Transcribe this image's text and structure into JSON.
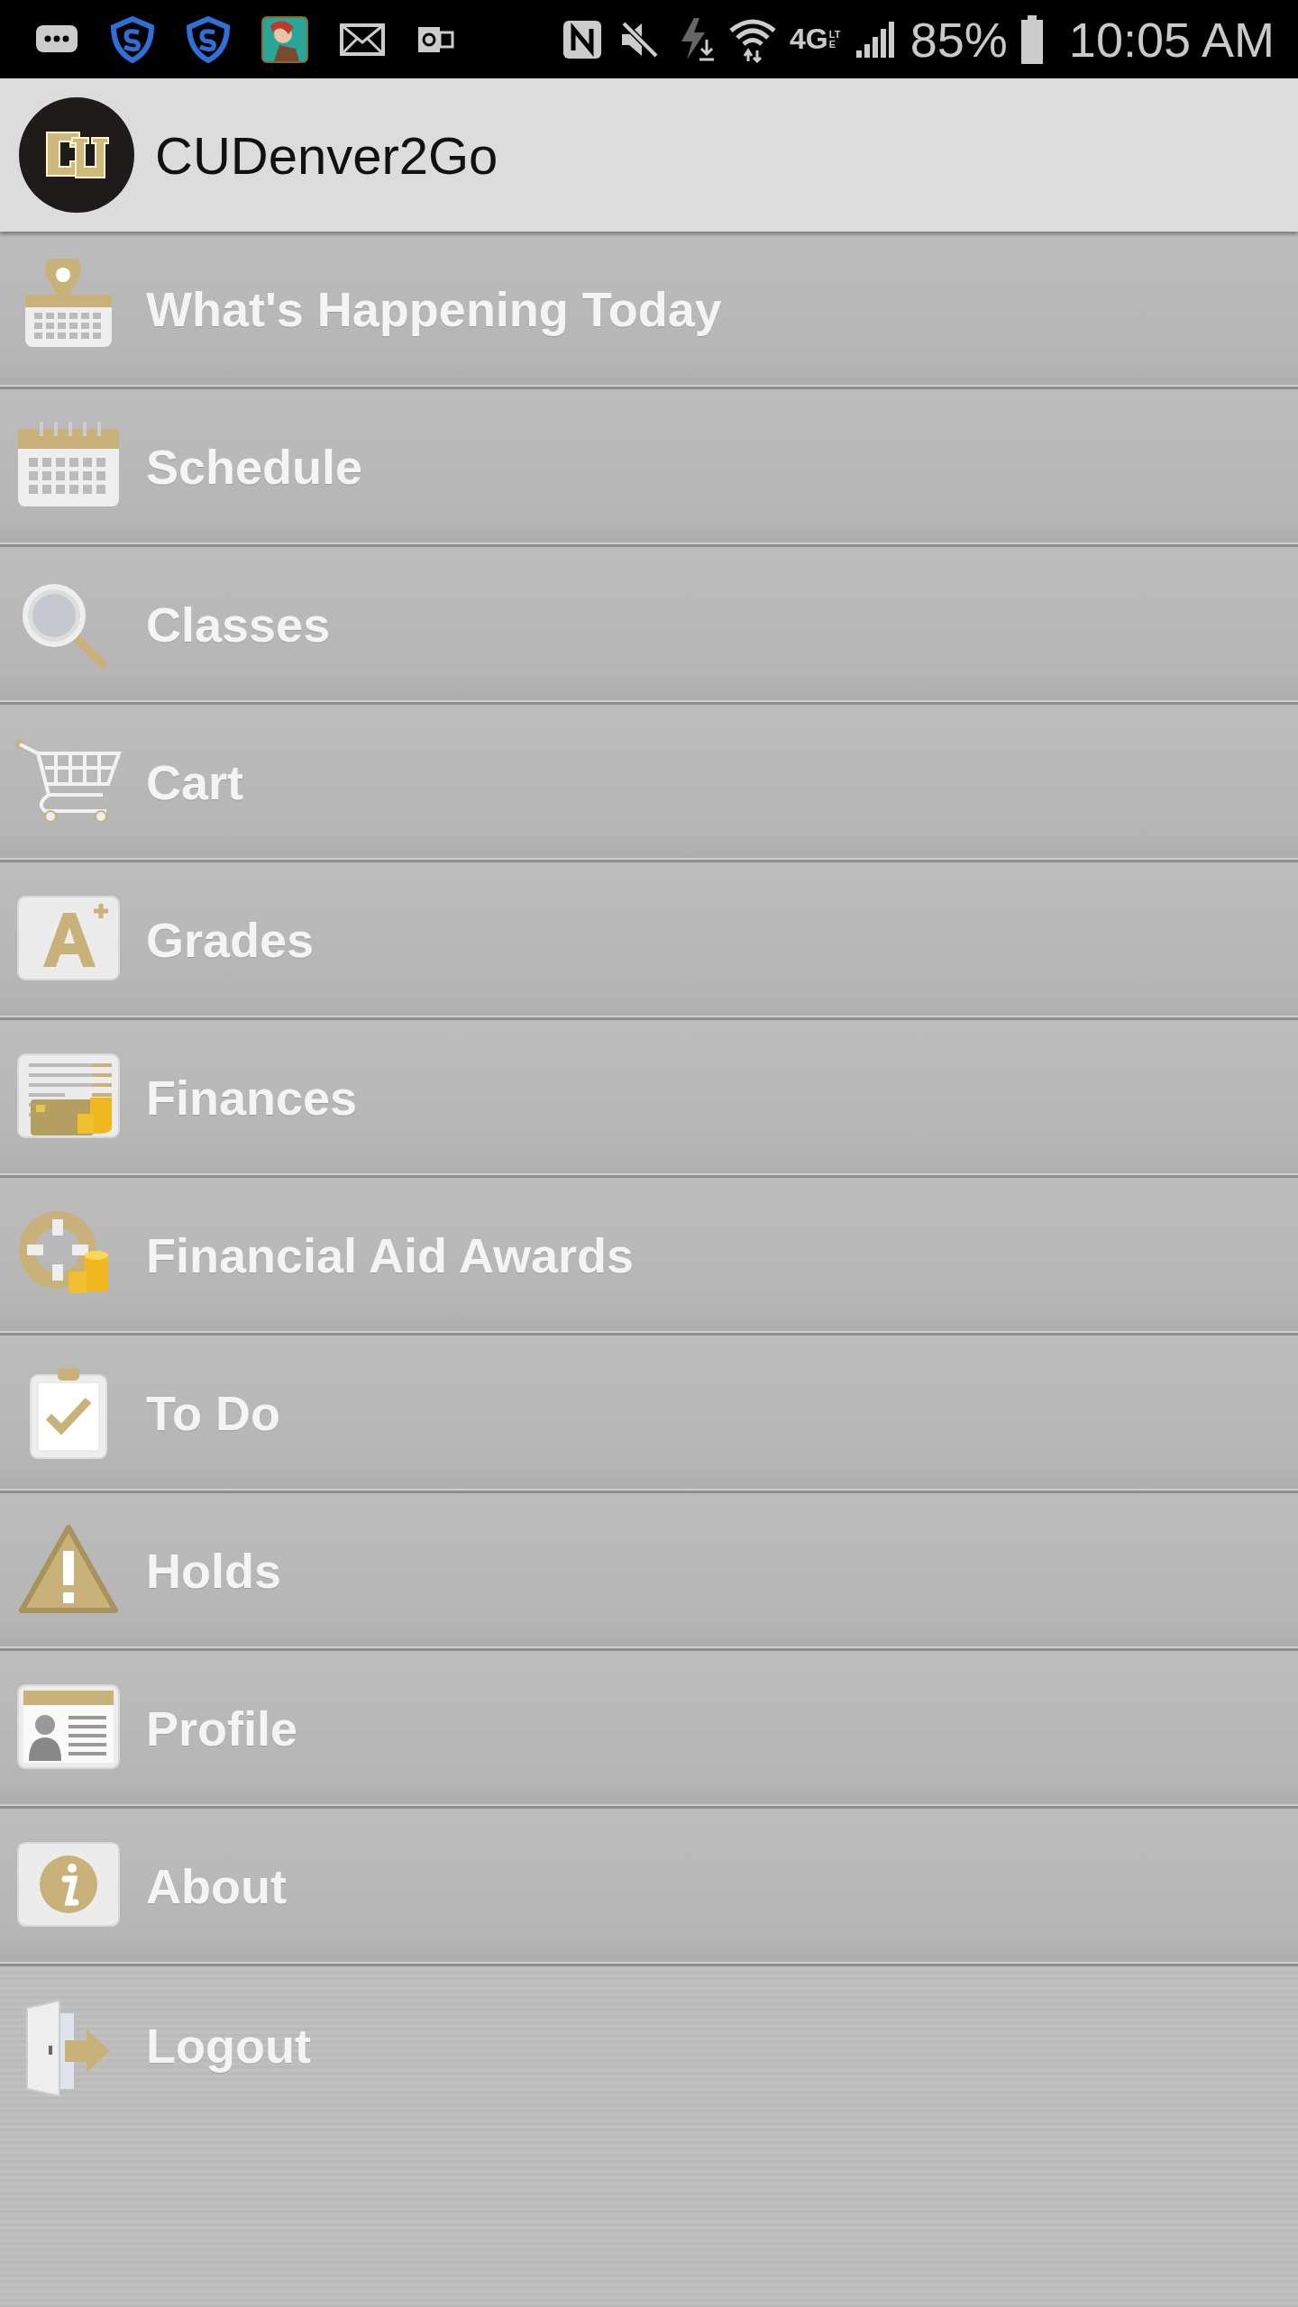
{
  "status_bar": {
    "network": "4G",
    "network_sub": "LTE",
    "battery": "85%",
    "time": "10:05 AM"
  },
  "app_bar": {
    "title": "CUDenver2Go"
  },
  "menu": [
    {
      "label": "What's Happening Today"
    },
    {
      "label": "Schedule"
    },
    {
      "label": "Classes"
    },
    {
      "label": "Cart"
    },
    {
      "label": "Grades"
    },
    {
      "label": "Finances"
    },
    {
      "label": "Financial Aid Awards"
    },
    {
      "label": "To Do"
    },
    {
      "label": "Holds"
    },
    {
      "label": "Profile"
    },
    {
      "label": "About"
    },
    {
      "label": "Logout"
    }
  ]
}
